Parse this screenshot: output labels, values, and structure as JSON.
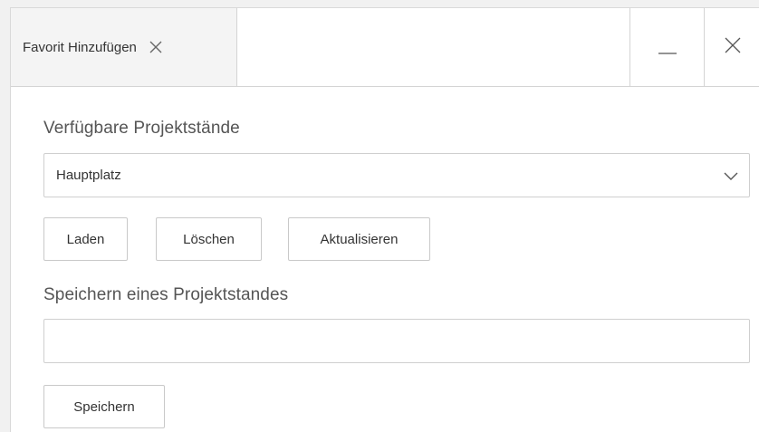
{
  "window": {
    "tab_title": "Favorit Hinzufügen",
    "tab_close_icon": "close-icon",
    "minimize_icon": "minimize-icon",
    "close_icon": "close-icon"
  },
  "project_states": {
    "label": "Verfügbare Projektstände",
    "selected": "Hauptplatz",
    "chevron_icon": "chevron-down-icon"
  },
  "actions": {
    "load_label": "Laden",
    "delete_label": "Löschen",
    "refresh_label": "Aktualisieren"
  },
  "save_state": {
    "label": "Speichern eines Projektstandes",
    "input_value": "",
    "input_placeholder": "",
    "save_label": "Speichern"
  },
  "colors": {
    "background": "#f1f1f1",
    "panel": "#ffffff",
    "tab_background": "#f4f4f4",
    "border": "#cfcfcf",
    "text": "#333333"
  }
}
